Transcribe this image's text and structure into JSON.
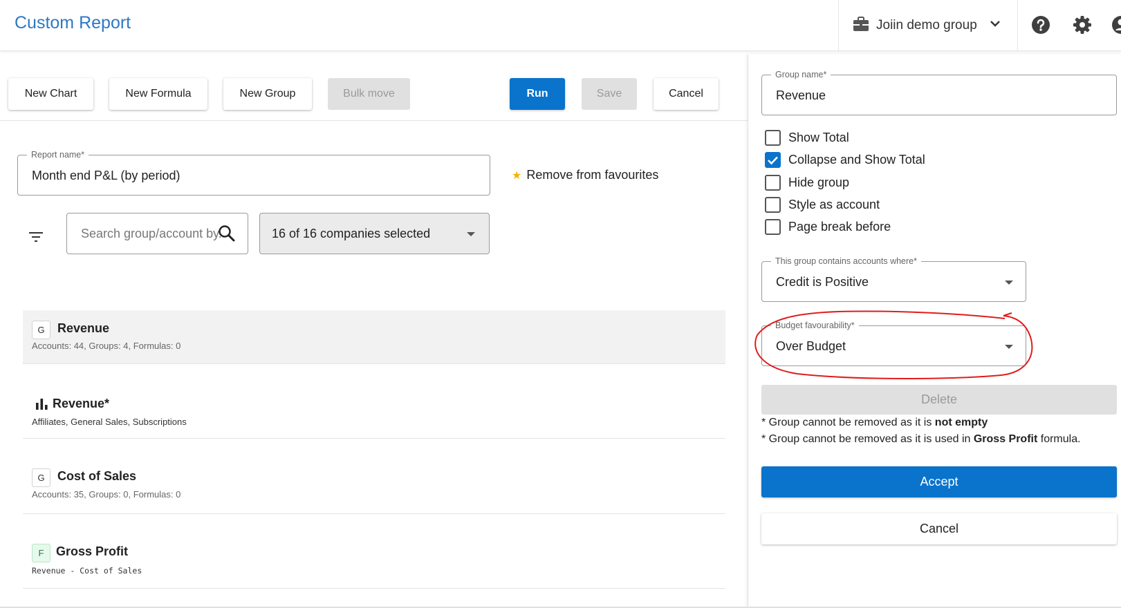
{
  "header": {
    "app_title": "Custom Report",
    "group_name": "Joiin demo group",
    "icons": [
      "briefcase-icon",
      "chevron-down-icon",
      "help-icon",
      "gear-icon",
      "account-icon"
    ]
  },
  "toolbar": {
    "new_chart": "New Chart",
    "new_formula": "New Formula",
    "new_group": "New Group",
    "bulk_move": "Bulk move",
    "run": "Run",
    "save": "Save",
    "cancel": "Cancel"
  },
  "report": {
    "name_label": "Report name*",
    "name_value": "Month end P&L (by period)",
    "favourites_label": "Remove from favourites"
  },
  "filters": {
    "search_placeholder": "Search group/account by...",
    "companies_value": "16 of 16 companies selected"
  },
  "rows": [
    {
      "badge": "G",
      "title": "Revenue",
      "sub": "Accounts: 44, Groups: 4, Formulas: 0"
    },
    {
      "badge": "chart",
      "title": "Revenue*",
      "sub": "Affiliates, General Sales, Subscriptions"
    },
    {
      "badge": "G",
      "title": "Cost of Sales",
      "sub": "Accounts: 35, Groups: 0, Formulas: 0"
    },
    {
      "badge": "F",
      "title": "Gross Profit",
      "sub": "Revenue - Cost of Sales"
    }
  ],
  "panel": {
    "group_name_label": "Group name*",
    "group_name_value": "Revenue",
    "checkboxes": [
      {
        "label": "Show Total",
        "checked": false
      },
      {
        "label": "Collapse and Show Total",
        "checked": true
      },
      {
        "label": "Hide group",
        "checked": false
      },
      {
        "label": "Style as account",
        "checked": false
      },
      {
        "label": "Page break before",
        "checked": false
      }
    ],
    "contains_label": "This group contains accounts where*",
    "contains_value": "Credit is Positive",
    "budget_label": "Budget favourability*",
    "budget_value": "Over Budget",
    "delete": "Delete",
    "note1_prefix": "* Group cannot be removed as it is ",
    "note1_bold": "not empty",
    "note2_prefix": "* Group cannot be removed as it is used in ",
    "note2_bold": "Gross Profit",
    "note2_suffix": " formula.",
    "accept": "Accept",
    "cancel": "Cancel"
  },
  "colors": {
    "accent": "#0a73cc",
    "title_blue": "#2d78c1",
    "annotation_red": "#e21b1b",
    "star": "#f4b400"
  }
}
